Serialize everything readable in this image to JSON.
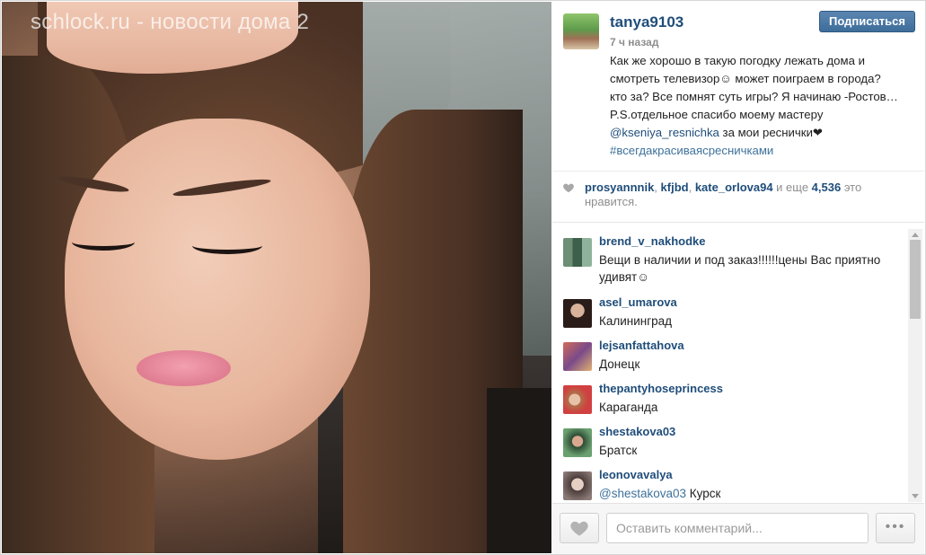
{
  "watermark": "schlock.ru - новости дома 2",
  "post": {
    "username": "tanya9103",
    "time": "7 ч назад",
    "follow_label": "Подписаться",
    "caption": {
      "line1": "Как же хорошо в такую погодку лежать дома и",
      "line2": "смотреть телевизор☺ может поиграем в города? ",
      "line3": "кто за? Все помнят суть игры? Я начинаю -Ростов…",
      "line4": "P.S.отдельное спасибо моему мастеру",
      "mention": "@kseniya_resnichka",
      "line5_rest": " за мои реснички❤",
      "hashtag": "#всегдакрасиваясресничками"
    }
  },
  "likes": {
    "users": [
      "prosyannnik",
      "kfjbd",
      "kate_orlova94"
    ],
    "sep": ", ",
    "more_text": " и еще ",
    "count": "4,536",
    "suffix": " это нравится."
  },
  "comments": [
    {
      "user": "brend_v_nakhodke",
      "text": "Вещи в наличии и под заказ!!!!!!цены Вас приятно удивят☺",
      "avatar_color": "#4c7a5a"
    },
    {
      "user": "asel_umarova",
      "text": "Калининград",
      "avatar_color": "#3a2a26"
    },
    {
      "user": "lejsanfattahova",
      "text": "Донецк",
      "avatar_color": "#a05a4a"
    },
    {
      "user": "thepantyhoseprincess",
      "text": "Караганда",
      "avatar_color": "#c98a78"
    },
    {
      "user": "shestakova03",
      "text": "Братск",
      "avatar_color": "#3f6d4b"
    },
    {
      "user": "leonovavalya",
      "mention": "@shestakova03",
      "text": " Курск",
      "avatar_color": "#6a5b58"
    }
  ],
  "composer": {
    "placeholder": "Оставить комментарий...",
    "more_label": "•••"
  }
}
